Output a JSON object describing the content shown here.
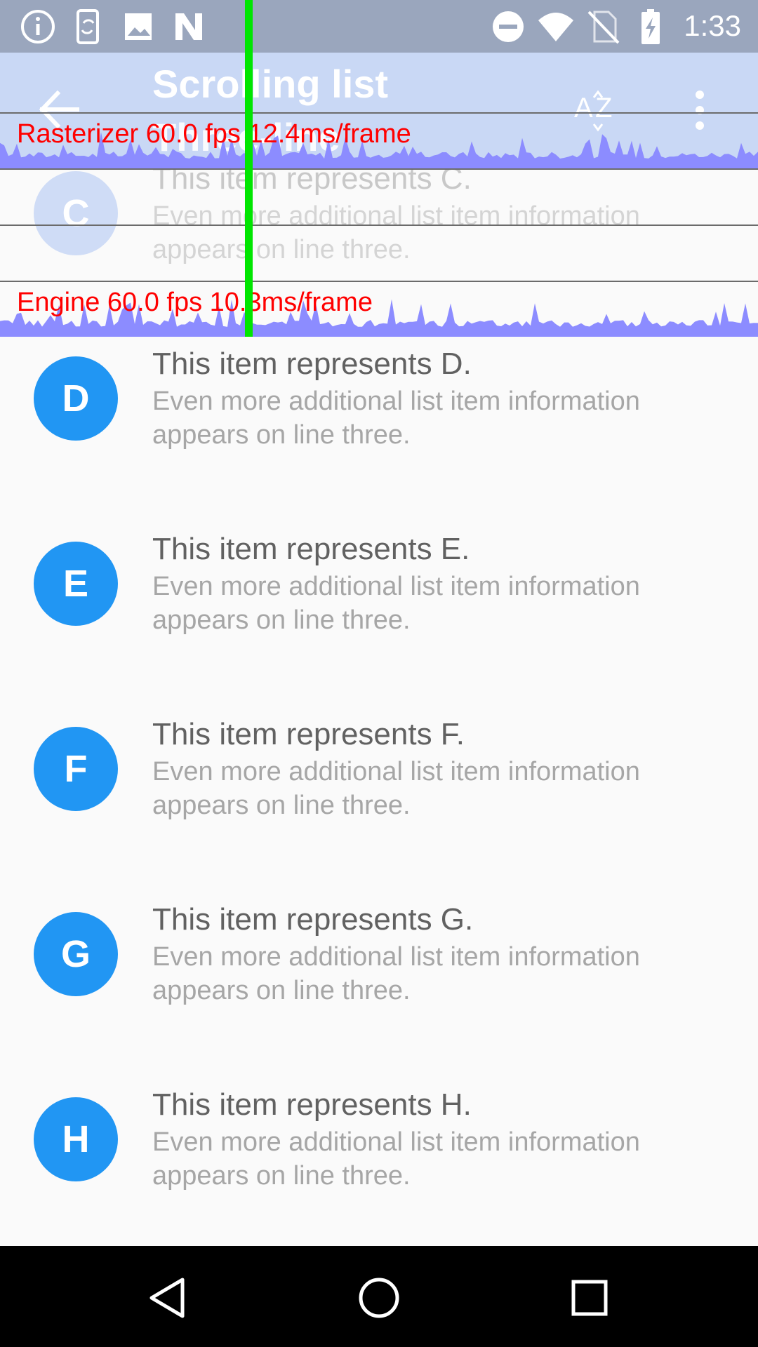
{
  "status_bar": {
    "time": "1:33",
    "left_icons": [
      "info-icon",
      "phone-sync-icon",
      "image-icon",
      "n-logo-icon"
    ],
    "right_icons": [
      "do-not-disturb-icon",
      "wifi-icon",
      "no-sim-icon",
      "battery-charging-icon"
    ]
  },
  "app_bar": {
    "title": "Scrolling list",
    "subtitle": "Three-line",
    "back_icon": "back-arrow-icon",
    "sort_icon": "sort-az-icon",
    "more_icon": "more-vert-icon"
  },
  "overlay": {
    "rasterizer": "Rasterizer  60.0 fps  12.4ms/frame",
    "engine": "Engine  60.0 fps  10.3ms/frame",
    "graph_color": "#8c8cff",
    "label_color": "#ff0000"
  },
  "list": {
    "items": [
      {
        "letter": "C",
        "title": "This item represents C.",
        "body": "Even more additional list item information appears on line three."
      },
      {
        "letter": "D",
        "title": "This item represents D.",
        "body": "Even more additional list item information appears on line three."
      },
      {
        "letter": "E",
        "title": "This item represents E.",
        "body": "Even more additional list item information appears on line three."
      },
      {
        "letter": "F",
        "title": "This item represents F.",
        "body": "Even more additional list item information appears on line three."
      },
      {
        "letter": "G",
        "title": "This item represents G.",
        "body": "Even more additional list item information appears on line three."
      },
      {
        "letter": "H",
        "title": "This item represents H.",
        "body": "Even more additional list item information appears on line three."
      }
    ]
  },
  "colors": {
    "accent": "#2196f3",
    "app_bar": "#c9d8f5",
    "status_bar": "#9aa6bd"
  },
  "nav_bar": {
    "buttons": [
      "back-triangle-icon",
      "home-circle-icon",
      "recents-square-icon"
    ]
  }
}
